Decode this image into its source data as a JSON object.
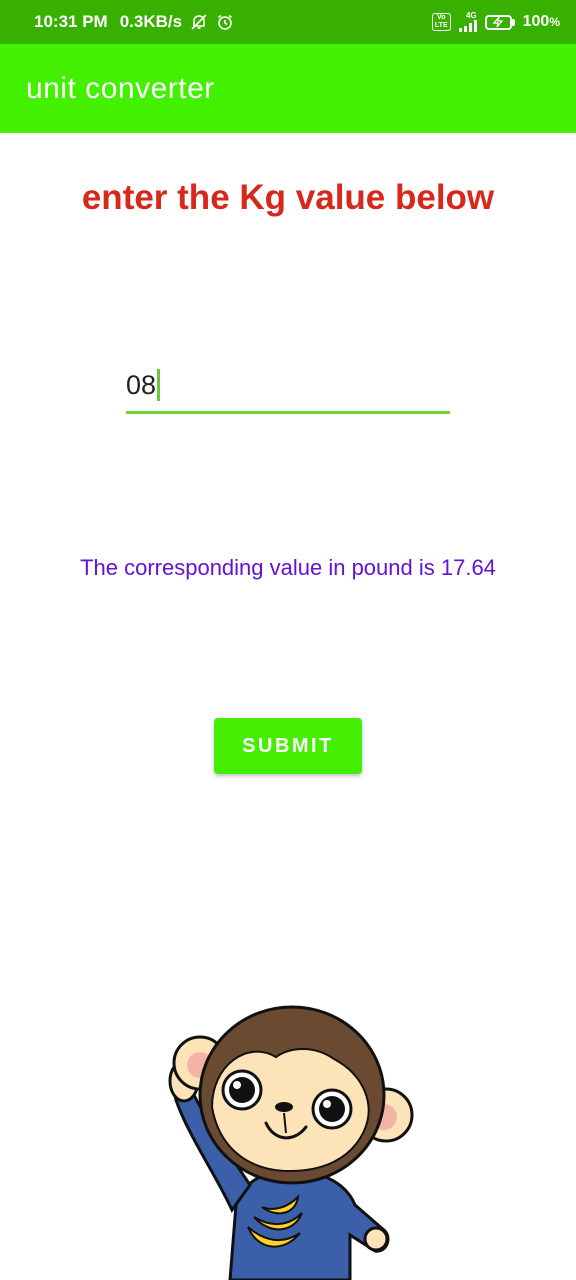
{
  "status_bar": {
    "time": "10:31 PM",
    "net_speed": "0.3KB/s",
    "icons": [
      "muted-bell-icon",
      "alarm-icon",
      "volte-icon",
      "signal-4g-icon",
      "battery-charging-icon"
    ],
    "volte_top": "Vo",
    "volte_bottom": "LTE",
    "network_type": "4G",
    "battery_percent": "100",
    "battery_unit": "%"
  },
  "app_bar": {
    "title": "unit converter"
  },
  "main": {
    "heading": "enter the Kg value below",
    "kg_input_value": "08",
    "result_text": "The corresponding value in pound is 17.64",
    "submit_label": "SUBMIT",
    "illustration": "waving-monkey-with-banana-shirt"
  },
  "colors": {
    "status_bar": "#38b000",
    "app_bar": "#42f000",
    "heading": "#d6281b",
    "result": "#6312d6",
    "button": "#44ee00",
    "input_underline": "#74d33a"
  }
}
